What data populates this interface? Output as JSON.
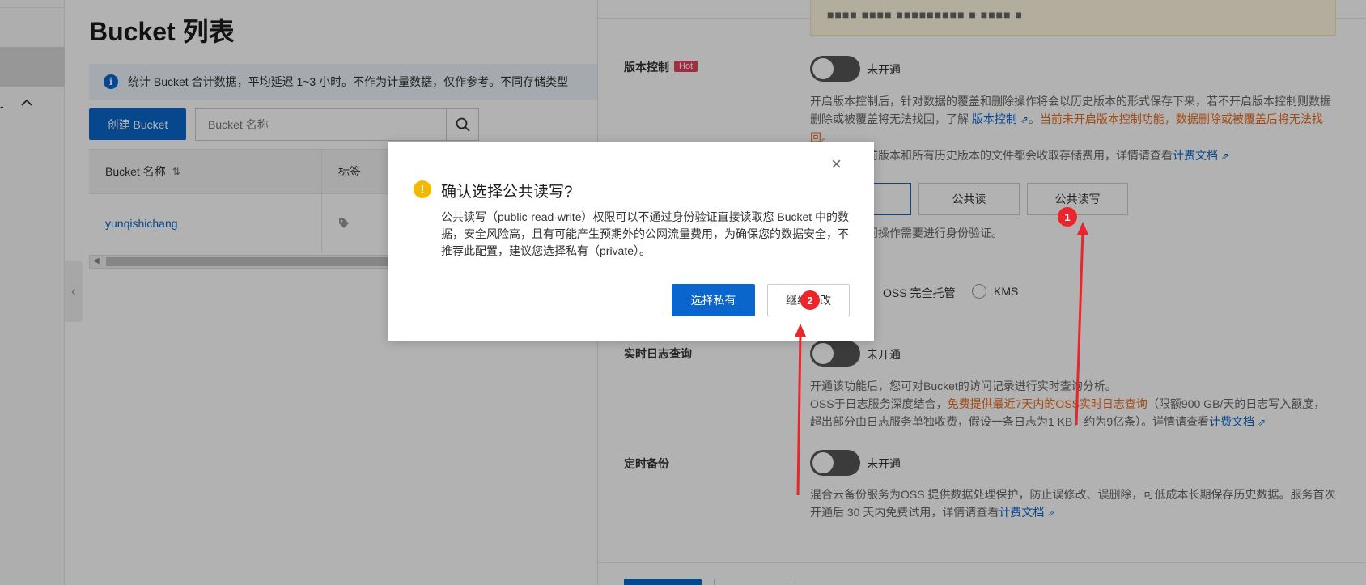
{
  "left_nav": {
    "dash": "-",
    "caret": "^",
    "collapse": "‹"
  },
  "page": {
    "title": "Bucket 列表",
    "info_text": "统计 Bucket 合计数据，平均延迟 1~3 小时。不作为计量数据，仅作参考。不同存储类型",
    "create_button": "创建 Bucket",
    "search_placeholder": "Bucket 名称",
    "table": {
      "headers": [
        "Bucket 名称",
        "标签"
      ],
      "rows": [
        {
          "name": "yunqishichang"
        }
      ]
    }
  },
  "panel": {
    "top_strip_text": "■■■■ ■■■■ ■■■■■■■■■ ■ ■■■■ ■",
    "versioning": {
      "label": "版本控制",
      "hot": "Hot",
      "status": "未开通",
      "desc1": "开启版本控制后，针对数据的覆盖和删除操作将会以历史版本的形式保存下来，若不开启版本控制则数据删除或被覆盖将无法找回，了解 ",
      "desc_link": "版本控制",
      "desc_warn": "当前未开启版本控制功能，数据删除或被覆盖后将无法找回。",
      "desc2": "件后，对当前版本和所有历史版本的文件都会收取存储费用，详情请查看",
      "billing_link": "计费文档"
    },
    "acl": {
      "options": [
        "",
        "公共读",
        "公共读写"
      ],
      "hint": "件的所有访问操作需要进行身份验证。"
    },
    "encryption": {
      "options": [
        "OSS 完全托管",
        "KMS"
      ]
    },
    "realtime_log": {
      "label": "实时日志查询",
      "status": "未开通",
      "desc1": "开通该功能后，您可对Bucket的访问记录进行实时查询分析。",
      "desc2_a": "OSS于日志服务深度结合，",
      "desc2_orange": "免费提供最近7天内的OSS实时日志查询",
      "desc2_b": "（限额900 GB/天的日志写入额度，超出部分由日志服务单独收费，假设一条日志为1 KB，约为9亿条）。详情请查看",
      "billing_link": "计费文档"
    },
    "backup": {
      "label": "定时备份",
      "status": "未开通",
      "desc": "混合云备份服务为OSS 提供数据处理保护，防止误修改、误删除，可低成本长期保存历史数据。服务首次开通后 30 天内免费试用，详情请查看",
      "billing_link": "计费文档"
    }
  },
  "dialog": {
    "close": "×",
    "warn_icon": "!",
    "title": "确认选择公共读写?",
    "body": "公共读写（public-read-write）权限可以不通过身份验证直接读取您 Bucket 中的数据，安全风险高，且有可能产生预期外的公网流量费用，为确保您的数据安全，不推荐此配置，建议您选择私有（private）。",
    "primary_button": "选择私有",
    "secondary_button": "继续修改"
  },
  "annotations": {
    "marker1": "1",
    "marker2": "2"
  },
  "colors": {
    "accent": "#0a66cc",
    "warning": "#f5b800",
    "annotation": "#e8262b",
    "hot": "#e6425e"
  }
}
